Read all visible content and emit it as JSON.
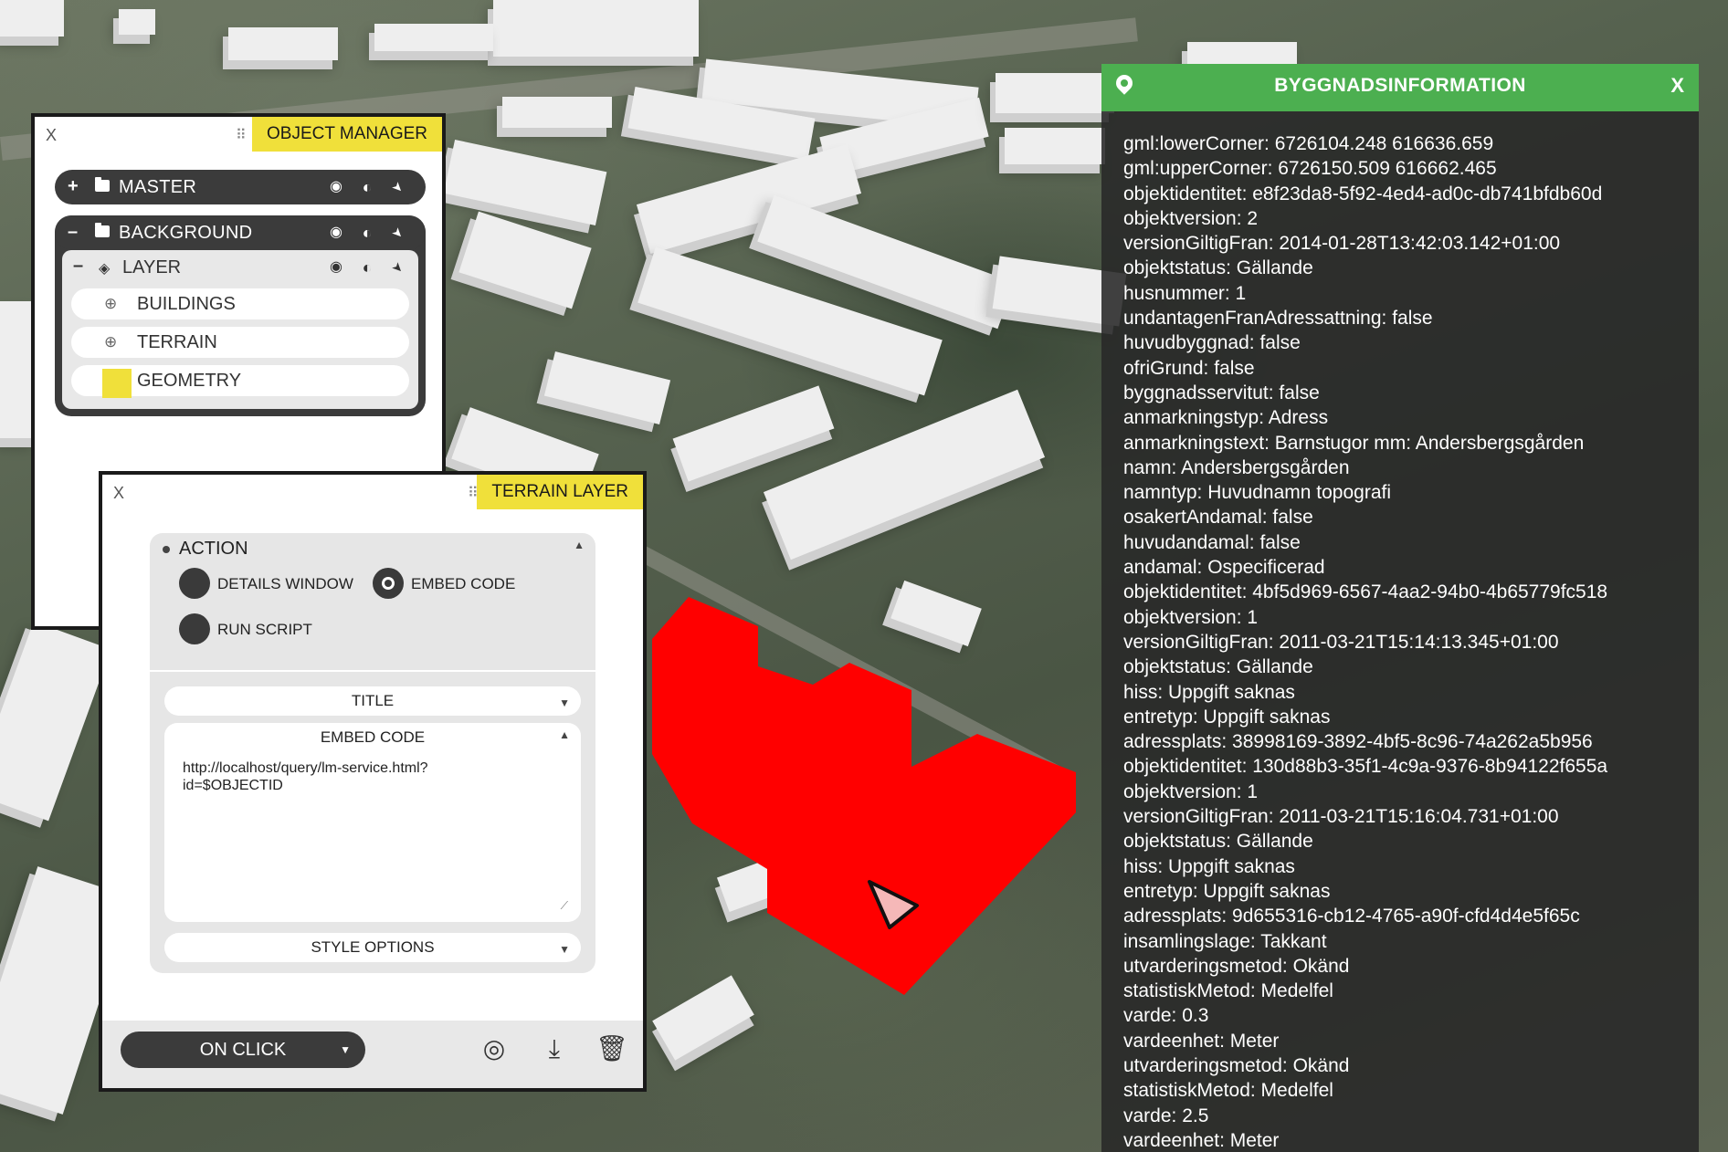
{
  "object_manager": {
    "close": "X",
    "title": "OBJECT MANAGER",
    "master": {
      "toggle": "+",
      "label": "MASTER"
    },
    "background": {
      "toggle": "–",
      "label": "BACKGROUND"
    },
    "layer": {
      "toggle": "–",
      "label": "LAYER"
    },
    "items": [
      {
        "label": "BUILDINGS",
        "icon": "globe-icon"
      },
      {
        "label": "TERRAIN",
        "icon": "globe-icon"
      },
      {
        "label": "GEOMETRY",
        "icon": "color-swatch",
        "swatch_color": "#f0e03a"
      }
    ]
  },
  "terrain_layer": {
    "close": "X",
    "title": "TERRAIN LAYER",
    "action": {
      "label": "ACTION",
      "options": [
        {
          "label": "DETAILS WINDOW",
          "selected": false
        },
        {
          "label": "EMBED CODE",
          "selected": true
        },
        {
          "label": "RUN SCRIPT",
          "selected": false
        }
      ]
    },
    "title_field": "TITLE",
    "embed_label": "EMBED CODE",
    "embed_code": "http://localhost/query/lm-service.html?\nid=$OBJECTID",
    "style_options": "STYLE OPTIONS",
    "trigger": "ON CLICK"
  },
  "info_panel": {
    "title": "BYGGNADSINFORMATION",
    "close": "X",
    "lines": [
      "gml:lowerCorner: 6726104.248 616636.659",
      "gml:upperCorner: 6726150.509 616662.465",
      "objektidentitet: e8f23da8-5f92-4ed4-ad0c-db741bfdb60d",
      "objektversion: 2",
      "versionGiltigFran: 2014-01-28T13:42:03.142+01:00",
      "objektstatus: Gällande",
      "husnummer: 1",
      "undantagenFranAdressattning: false",
      "huvudbyggnad: false",
      "ofriGrund: false",
      "byggnadsservitut: false",
      "anmarkningstyp: Adress",
      "anmarkningstext: Barnstugor mm: Andersbergsgården",
      "namn: Andersbergsgården",
      "namntyp: Huvudnamn topografi",
      "osakertAndamal: false",
      "huvudandamal: false",
      "andamal: Ospecificerad",
      "objektidentitet: 4bf5d969-6567-4aa2-94b0-4b65779fc518",
      "objektversion: 1",
      "versionGiltigFran: 2011-03-21T15:14:13.345+01:00",
      "objektstatus: Gällande",
      "hiss: Uppgift saknas",
      "entretyp: Uppgift saknas",
      "adressplats: 38998169-3892-4bf5-8c96-74a262a5b956",
      "objektidentitet: 130d88b3-35f1-4c9a-9376-8b94122f655a",
      "objektversion: 1",
      "versionGiltigFran: 2011-03-21T15:16:04.731+01:00",
      "objektstatus: Gällande",
      "hiss: Uppgift saknas",
      "entretyp: Uppgift saknas",
      "adressplats: 9d655316-cb12-4765-a90f-cfd4d4e5f65c",
      "insamlingslage: Takkant",
      "utvarderingsmetod: Okänd",
      "statistiskMetod: Medelfel",
      "varde: 0.3",
      "vardeenhet: Meter",
      "utvarderingsmetod: Okänd",
      "statistiskMetod: Medelfel",
      "varde: 2.5",
      "vardeenhet: Meter"
    ]
  },
  "colors": {
    "accent_yellow": "#f0e03a",
    "header_green": "#4caf50",
    "selected_building": "#ff0000",
    "panel_dark": "#3b3b3b"
  }
}
